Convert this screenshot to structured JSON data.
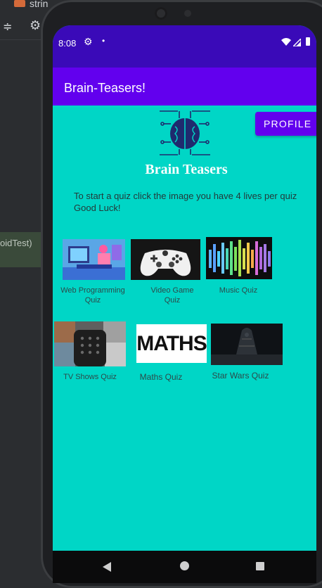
{
  "ide": {
    "tab_text": "strin",
    "test_label": "oidTest)"
  },
  "status": {
    "time": "8:08"
  },
  "app": {
    "title": "Brain-Teasers!",
    "profile_button": "PROFILE",
    "logo_title": "Brain Teasers",
    "instructions": "To start a quiz click the image you have 4 lives per quiz Good Luck!"
  },
  "quizzes": [
    {
      "label": "Web Programming Quiz",
      "icon": "web-programming-thumbnail"
    },
    {
      "label": "Video Game Quiz",
      "icon": "game-controller-thumbnail"
    },
    {
      "label": "Music Quiz",
      "icon": "music-spectrum-thumbnail"
    },
    {
      "label": "TV Shows Quiz",
      "icon": "tv-remote-thumbnail"
    },
    {
      "label": "Maths Quiz",
      "icon": "maths-thumbnail",
      "thumb_text": "MATHS"
    },
    {
      "label": "Star Wars Quiz",
      "icon": "star-wars-thumbnail"
    }
  ],
  "colors": {
    "status_bar": "#3a0ab8",
    "app_bar": "#6200ee",
    "background": "#00d6c6",
    "button": "#6200ee"
  }
}
